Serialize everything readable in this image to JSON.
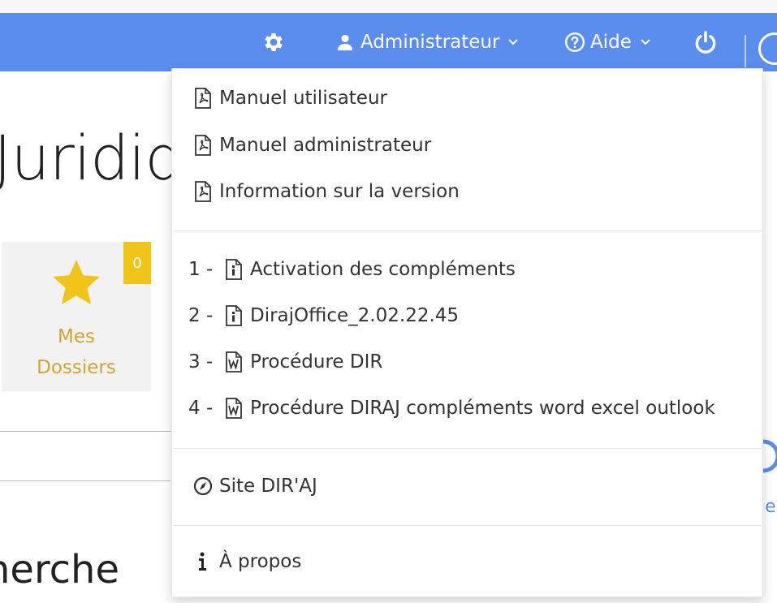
{
  "navbar": {
    "admin_label": "Administrateur",
    "aide_label": "Aide"
  },
  "page": {
    "title": "Juridiq",
    "tile_label_line1": "Mes",
    "tile_label_line2": "Dossiers",
    "tile_badge": "0",
    "search_heading": "herche",
    "right_fragment": "ie"
  },
  "dropdown": {
    "manuals": [
      {
        "label": "Manuel utilisateur",
        "icon": "pdf-icon"
      },
      {
        "label": "Manuel administrateur",
        "icon": "pdf-icon"
      },
      {
        "label": "Information sur la version",
        "icon": "pdf-icon"
      }
    ],
    "documents": [
      {
        "number": "1 -",
        "label": "Activation des compléments",
        "icon": "info-file-icon"
      },
      {
        "number": "2 -",
        "label": "DirajOffice_2.02.22.45",
        "icon": "info-file-icon"
      },
      {
        "number": "3 -",
        "label": "Procédure DIR",
        "icon": "word-file-icon"
      },
      {
        "number": "4 -",
        "label": "Procédure DIRAJ compléments word excel outlook",
        "icon": "word-file-icon"
      }
    ],
    "site_label": "Site DIR'AJ",
    "about_label": "À propos"
  },
  "colors": {
    "navbar": "#5b8def",
    "badge": "#f0c419",
    "tile_text": "#d4a233"
  }
}
